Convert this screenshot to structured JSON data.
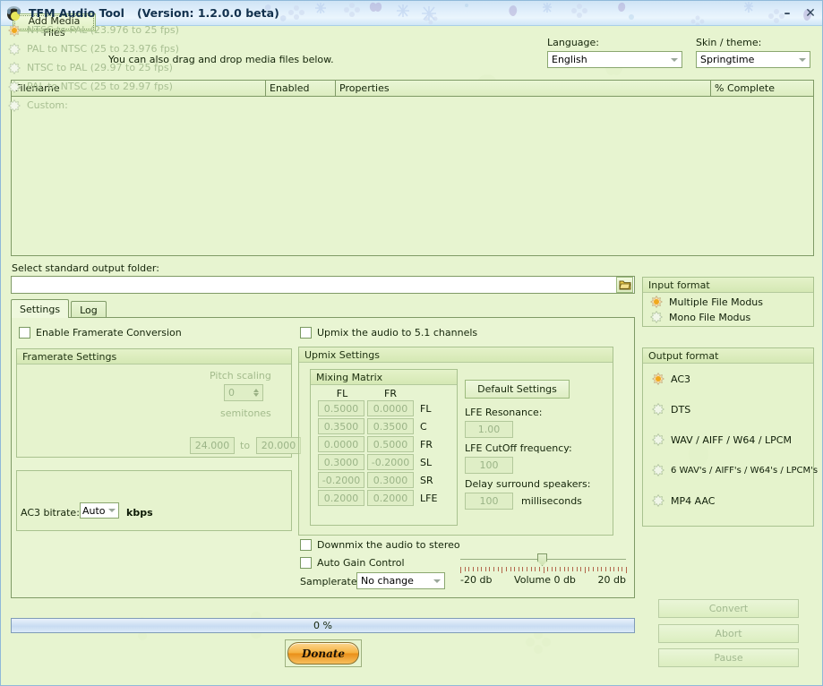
{
  "window": {
    "title": "TFM Audio Tool",
    "version": "(Version: 1.2.0.0 beta)",
    "minimize": "–",
    "close": "✕"
  },
  "toolbar": {
    "add_media_label": "Add Media Files",
    "drag_hint": "You can also drag and drop media files below.",
    "language_label": "Language:",
    "language_value": "English",
    "skin_label": "Skin / theme:",
    "skin_value": "Springtime"
  },
  "filelist": {
    "columns": [
      "Filename",
      "Enabled",
      "Properties",
      "% Complete"
    ],
    "rows": []
  },
  "output_folder": {
    "label": "Select standard output folder:",
    "value": "",
    "placeholder": "",
    "browse_icon": "folder-icon"
  },
  "tabs": [
    {
      "label": "Settings",
      "active": true
    },
    {
      "label": "Log",
      "active": false
    }
  ],
  "settings": {
    "enable_framerate_conversion": {
      "label": "Enable Framerate Conversion",
      "checked": false
    },
    "framerate_group_title": "Framerate Settings",
    "framerate_options": [
      {
        "label": "NTSC to PAL (23.976 to 25 fps)",
        "selected": true
      },
      {
        "label": "PAL to NTSC (25 to 23.976 fps)",
        "selected": false
      },
      {
        "label": "NTSC to PAL (29.97 to 25 fps)",
        "selected": false
      },
      {
        "label": "PAL to NTSC (25 to 29.97 fps)",
        "selected": false
      },
      {
        "label": "Custom:",
        "selected": false
      }
    ],
    "custom_from": "24.000",
    "custom_to_label": "to",
    "custom_to": "20.000",
    "pitch_scaling_label": "Pitch scaling",
    "pitch_scaling_value": "0",
    "semitones_label": "semitones",
    "ac3_bitrate_label": "AC3 bitrate:",
    "ac3_bitrate_value": "Auto",
    "ac3_bitrate_unit": "kbps"
  },
  "upmix": {
    "enable": {
      "label": "Upmix the audio to 5.1 channels",
      "checked": false
    },
    "group_title": "Upmix Settings",
    "matrix": {
      "title": "Mixing Matrix",
      "columns": [
        "FL",
        "FR"
      ],
      "rows": [
        {
          "name": "FL",
          "values": [
            "0.5000",
            "0.0000"
          ]
        },
        {
          "name": "C",
          "values": [
            "0.3500",
            "0.3500"
          ]
        },
        {
          "name": "FR",
          "values": [
            "0.0000",
            "0.5000"
          ]
        },
        {
          "name": "SL",
          "values": [
            "0.3000",
            "-0.2000"
          ]
        },
        {
          "name": "SR",
          "values": [
            "-0.2000",
            "0.3000"
          ]
        },
        {
          "name": "LFE",
          "values": [
            "0.2000",
            "0.2000"
          ]
        }
      ]
    },
    "default_settings_label": "Default Settings",
    "lfe_resonance_label": "LFE Resonance:",
    "lfe_resonance_value": "1.00",
    "lfe_cutoff_label": "LFE CutOff frequency:",
    "lfe_cutoff_value": "100",
    "delay_label": "Delay surround speakers:",
    "delay_value": "100",
    "delay_unit": "milliseconds"
  },
  "audio": {
    "downmix": {
      "label": "Downmix the audio to stereo",
      "checked": false
    },
    "auto_gain": {
      "label": "Auto Gain Control",
      "checked": false
    },
    "samplerate_label": "Samplerate:",
    "samplerate_value": "No change",
    "volume_min_label": "-20 db",
    "volume_center_label": "Volume 0 db",
    "volume_max_label": "20 db",
    "volume_value": 0
  },
  "input_format": {
    "title": "Input format",
    "options": [
      {
        "label": "Multiple File Modus",
        "selected": true
      },
      {
        "label": "Mono File Modus",
        "selected": false
      }
    ]
  },
  "output_format": {
    "title": "Output format",
    "options": [
      {
        "label": "AC3",
        "selected": true
      },
      {
        "label": "DTS",
        "selected": false
      },
      {
        "label": "WAV / AIFF / W64 / LPCM",
        "selected": false
      },
      {
        "label": "6 WAV's / AIFF's / W64's / LPCM's",
        "selected": false
      },
      {
        "label": "MP4 AAC",
        "selected": false
      }
    ]
  },
  "actions": {
    "convert": "Convert",
    "abort": "Abort",
    "pause": "Pause",
    "donate": "Donate"
  },
  "progress": {
    "text": "0 %",
    "value": 0
  },
  "colors": {
    "background": "#e7f4d0",
    "panel": "#e9f5d3",
    "titlebar": "#cfe4f5",
    "border": "#7f9a66",
    "radio_accent": "#f0a81e",
    "donate": "#f6b03c",
    "disabled_text": "#a8bf92"
  }
}
